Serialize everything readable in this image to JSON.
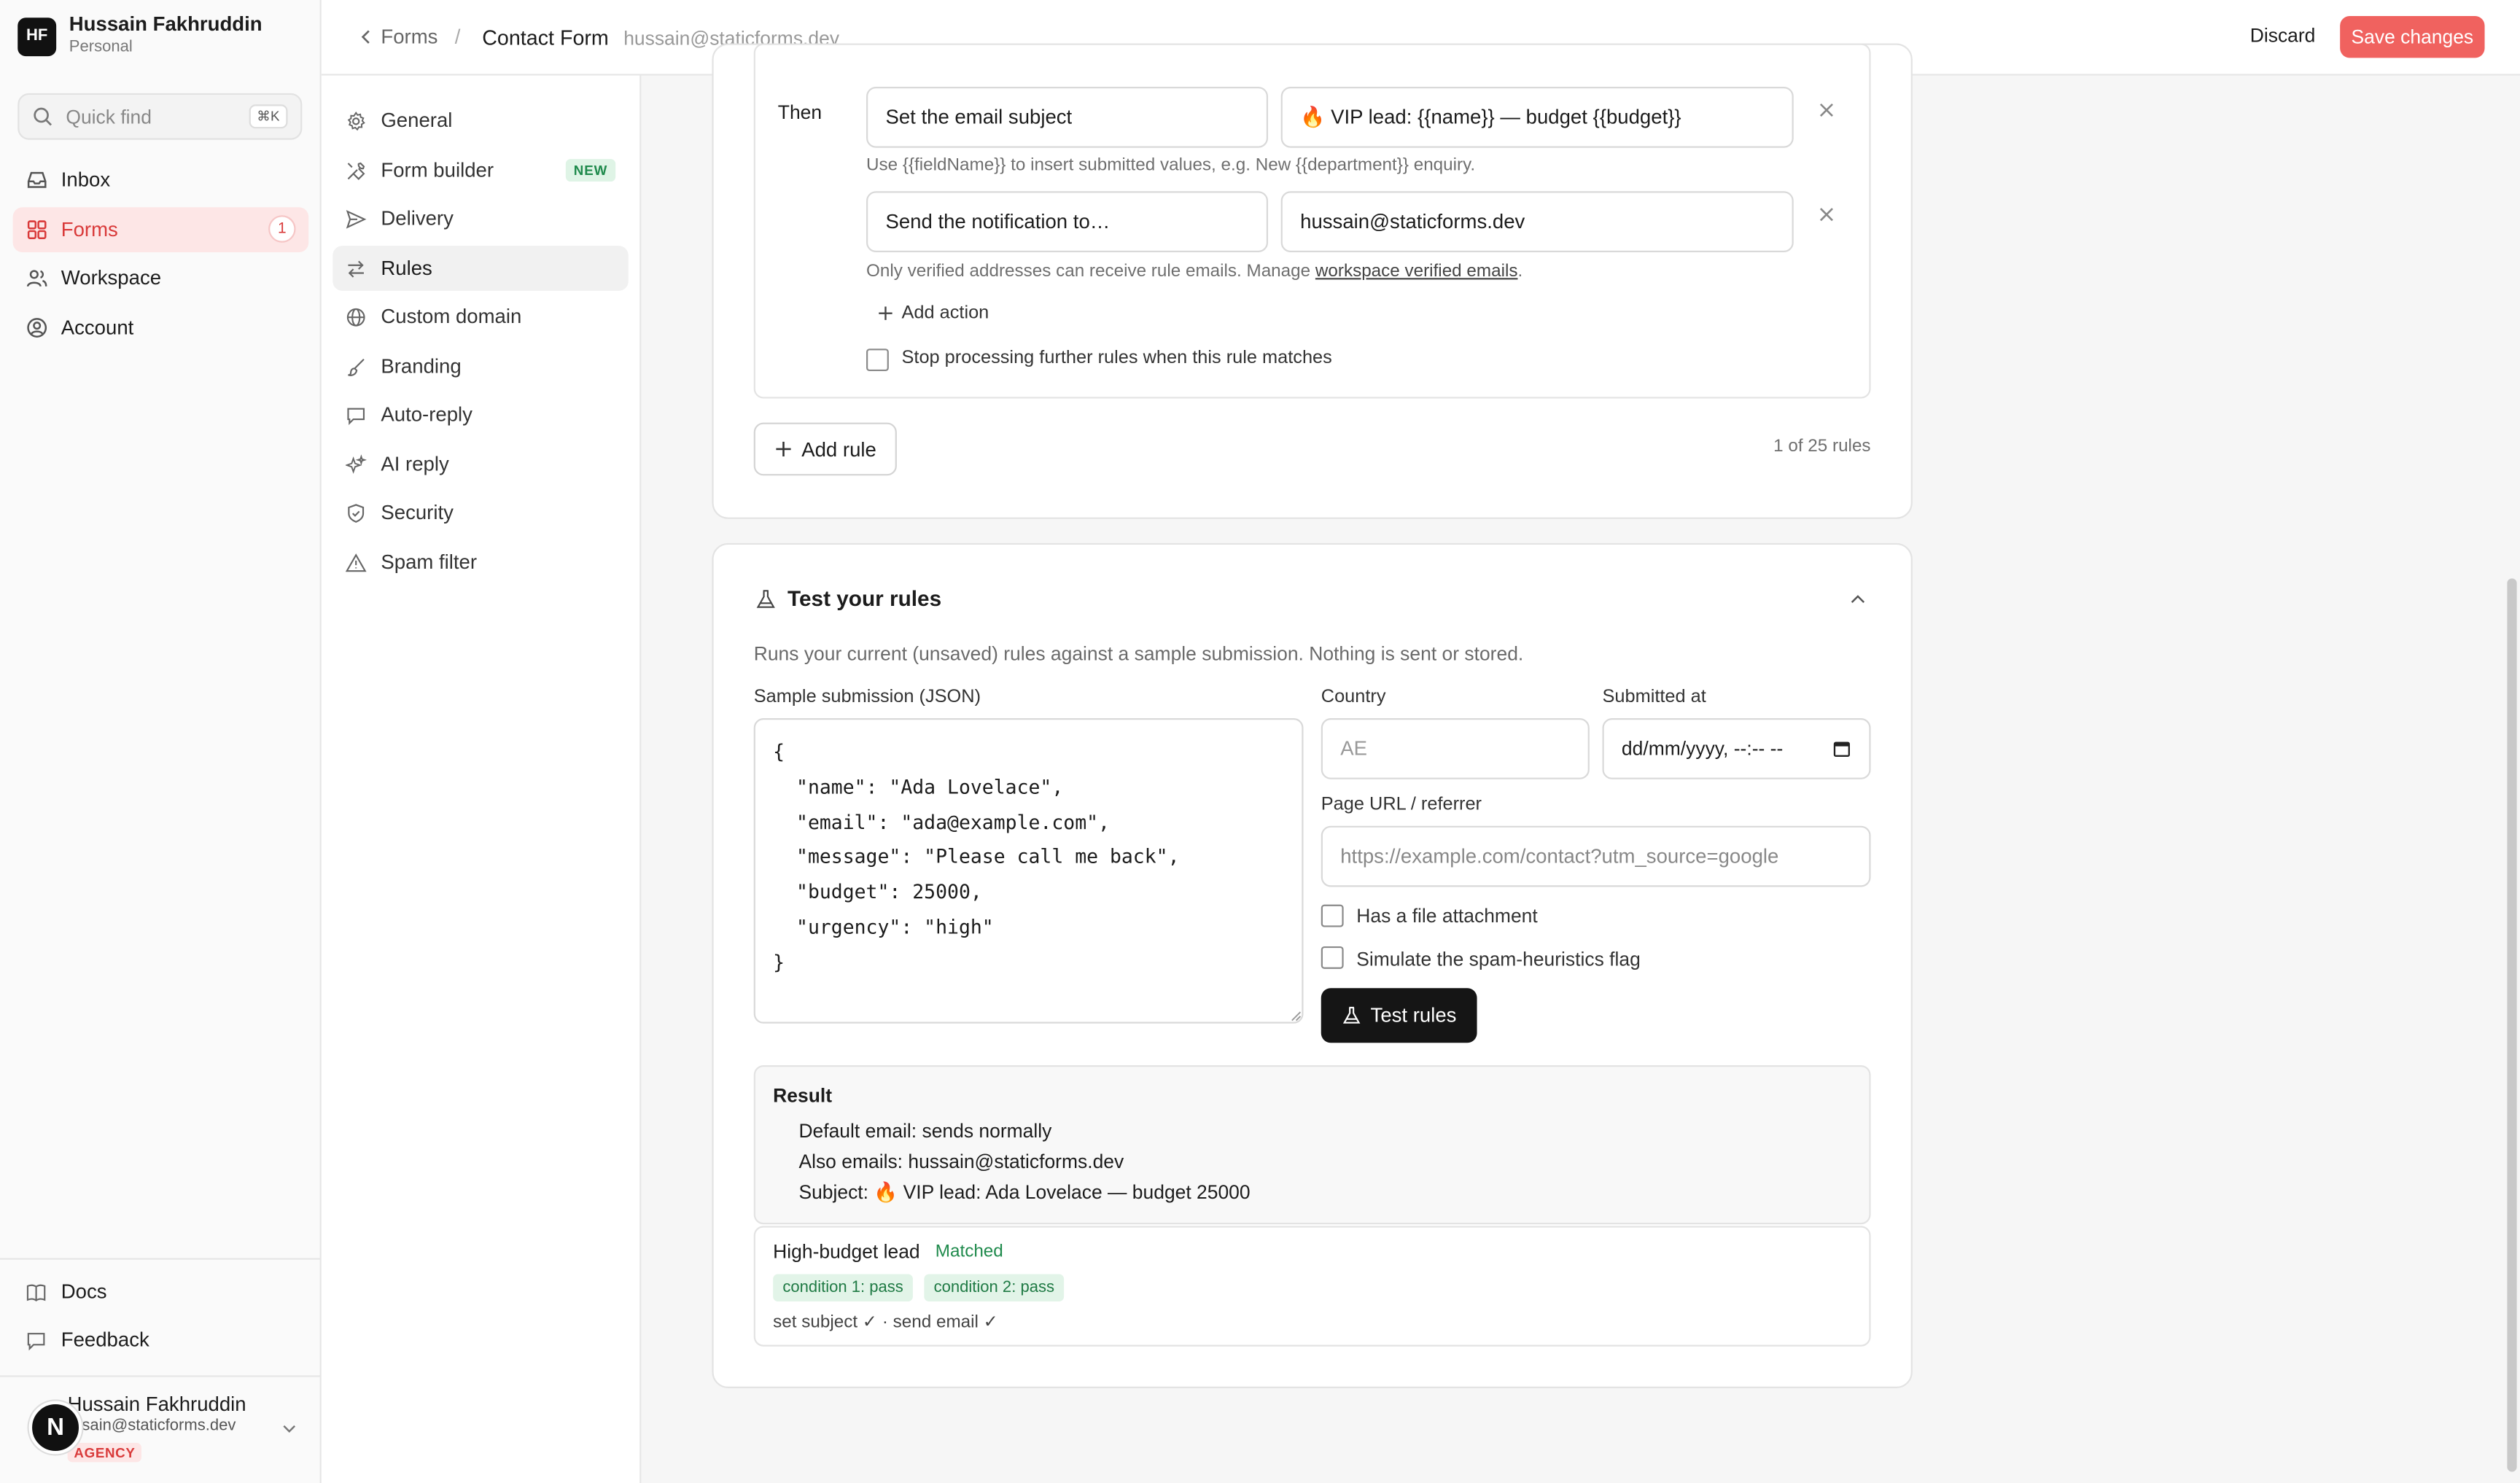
{
  "account": {
    "initials": "HF",
    "name": "Hussain Fakhruddin",
    "plan": "Personal"
  },
  "search": {
    "placeholder": "Quick find",
    "shortcut": "⌘K"
  },
  "sidebar": {
    "items": [
      {
        "label": "Inbox",
        "icon": "inbox-icon"
      },
      {
        "label": "Forms",
        "icon": "grid-icon",
        "count": "1",
        "active": true
      },
      {
        "label": "Workspace",
        "icon": "users-icon"
      },
      {
        "label": "Account",
        "icon": "user-circle-icon"
      }
    ],
    "bottom": [
      {
        "label": "Docs",
        "icon": "book-icon"
      },
      {
        "label": "Feedback",
        "icon": "chat-icon"
      }
    ],
    "user": {
      "avatar": "N",
      "name": "Hussain Fakhruddin",
      "email": "ssain@staticforms.dev",
      "badge": "AGENCY"
    }
  },
  "topbar": {
    "back_label": "Forms",
    "separator": "/",
    "form_name": "Contact Form",
    "form_email": "hussain@staticforms.dev",
    "discard_label": "Discard",
    "save_label": "Save changes"
  },
  "subnav": {
    "items": [
      {
        "label": "General",
        "icon": "gear-icon"
      },
      {
        "label": "Form builder",
        "icon": "tools-icon",
        "badge": "NEW"
      },
      {
        "label": "Delivery",
        "icon": "send-icon"
      },
      {
        "label": "Rules",
        "icon": "arrows-icon",
        "active": true
      },
      {
        "label": "Custom domain",
        "icon": "globe-icon"
      },
      {
        "label": "Branding",
        "icon": "brush-icon"
      },
      {
        "label": "Auto-reply",
        "icon": "reply-icon"
      },
      {
        "label": "AI reply",
        "icon": "sparkle-icon"
      },
      {
        "label": "Security",
        "icon": "shield-icon"
      },
      {
        "label": "Spam filter",
        "icon": "warning-icon"
      }
    ]
  },
  "rule": {
    "then_label": "Then",
    "actions": [
      {
        "type": "Set the email subject",
        "value": "🔥 VIP lead: {{name}} — budget {{budget}}"
      },
      {
        "type": "Send the notification to…",
        "value": "hussain@staticforms.dev"
      }
    ],
    "help_subject": "Use {{fieldName}} to insert submitted values, e.g. New {{department}} enquiry.",
    "help_verified_prefix": "Only verified addresses can receive rule emails. Manage ",
    "help_verified_link": "workspace verified emails",
    "help_verified_suffix": ".",
    "add_action_label": "Add action",
    "stop_label": "Stop processing further rules when this rule matches",
    "stop_checked": false
  },
  "rules_footer": {
    "add_rule_label": "Add rule",
    "count_text": "1 of 25 rules"
  },
  "test": {
    "title": "Test your rules",
    "description": "Runs your current (unsaved) rules against a sample submission. Nothing is sent or stored.",
    "json_label": "Sample submission (JSON)",
    "json_value": "{\n  \"name\": \"Ada Lovelace\",\n  \"email\": \"ada@example.com\",\n  \"message\": \"Please call me back\",\n  \"budget\": 25000,\n  \"urgency\": \"high\"\n}",
    "country_label": "Country",
    "country_placeholder": "AE",
    "submitted_label": "Submitted at",
    "submitted_placeholder": "dd/mm/yyyy, --:-- --",
    "url_label": "Page URL / referrer",
    "url_placeholder": "https://example.com/contact?utm_source=google",
    "attachment_label": "Has a file attachment",
    "spam_label": "Simulate the spam-heuristics flag",
    "test_button_label": "Test rules"
  },
  "result": {
    "title": "Result",
    "lines": [
      "Default email: sends normally",
      "Also emails: hussain@staticforms.dev",
      "Subject: 🔥 VIP lead: Ada Lovelace — budget 25000"
    ]
  },
  "match": {
    "rule_name": "High-budget lead",
    "status": "Matched",
    "conditions": [
      "condition 1: pass",
      "condition 2: pass"
    ],
    "actions_text": "set subject ✓ · send email ✓"
  },
  "colors": {
    "accent": "#f0625f",
    "accent_text": "#d93a3a",
    "success": "#1f8a4c"
  }
}
